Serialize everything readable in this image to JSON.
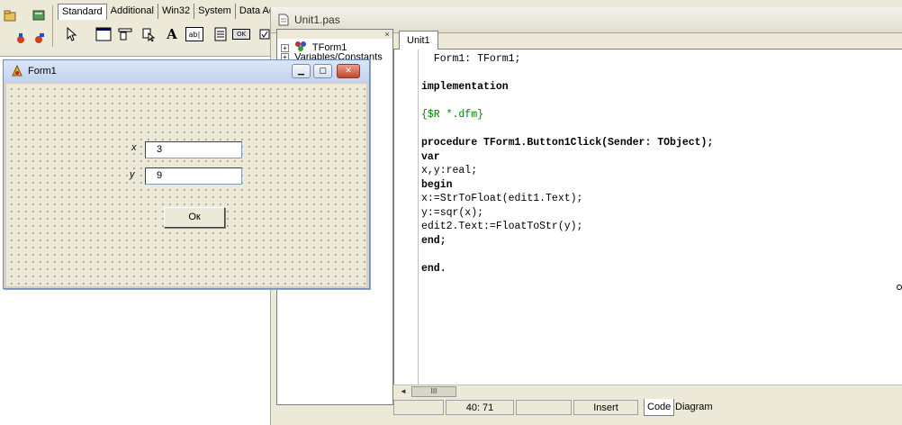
{
  "palette": {
    "tabs": [
      "Standard",
      "Additional",
      "Win32",
      "System",
      "Data Acce"
    ],
    "active_tab": "Standard",
    "label_component_glyph": "A",
    "edit_component_glyph": "ab|",
    "button_component_glyph": "OK"
  },
  "editor": {
    "title": "Unit1.pas",
    "explorer": {
      "items": [
        "TForm1",
        "Variables/Constants"
      ]
    },
    "tab": "Unit1",
    "code_lines": [
      {
        "text": "  Form1: TForm1;",
        "style": ""
      },
      {
        "text": "",
        "style": ""
      },
      {
        "text": "implementation",
        "style": "kw"
      },
      {
        "text": "",
        "style": ""
      },
      {
        "text": "{$R *.dfm}",
        "style": "dir"
      },
      {
        "text": "",
        "style": ""
      },
      {
        "text": "procedure TForm1.Button1Click(Sender: TObject);",
        "style": "kw"
      },
      {
        "text": "var",
        "style": "kw"
      },
      {
        "text": "x,y:real;",
        "style": ""
      },
      {
        "text": "begin",
        "style": "kw"
      },
      {
        "text": "x:=StrToFloat(edit1.Text);",
        "style": ""
      },
      {
        "text": "y:=sqr(x);",
        "style": ""
      },
      {
        "text": "edit2.Text:=FloatToStr(y);",
        "style": ""
      },
      {
        "text": "end;",
        "style": "kw"
      },
      {
        "text": "",
        "style": ""
      },
      {
        "text": "end.",
        "style": "kw"
      }
    ],
    "scroll_thumb_glyph": "III",
    "status": {
      "position": "40:  71",
      "mode": "Insert"
    },
    "bottom_tabs": [
      "Code",
      "Diagram"
    ],
    "active_bottom_tab": "Code"
  },
  "form": {
    "title": "Form1",
    "label_x": "x",
    "label_y": "y",
    "edit1_value": "3",
    "edit2_value": "9",
    "button_label": "Ок"
  }
}
